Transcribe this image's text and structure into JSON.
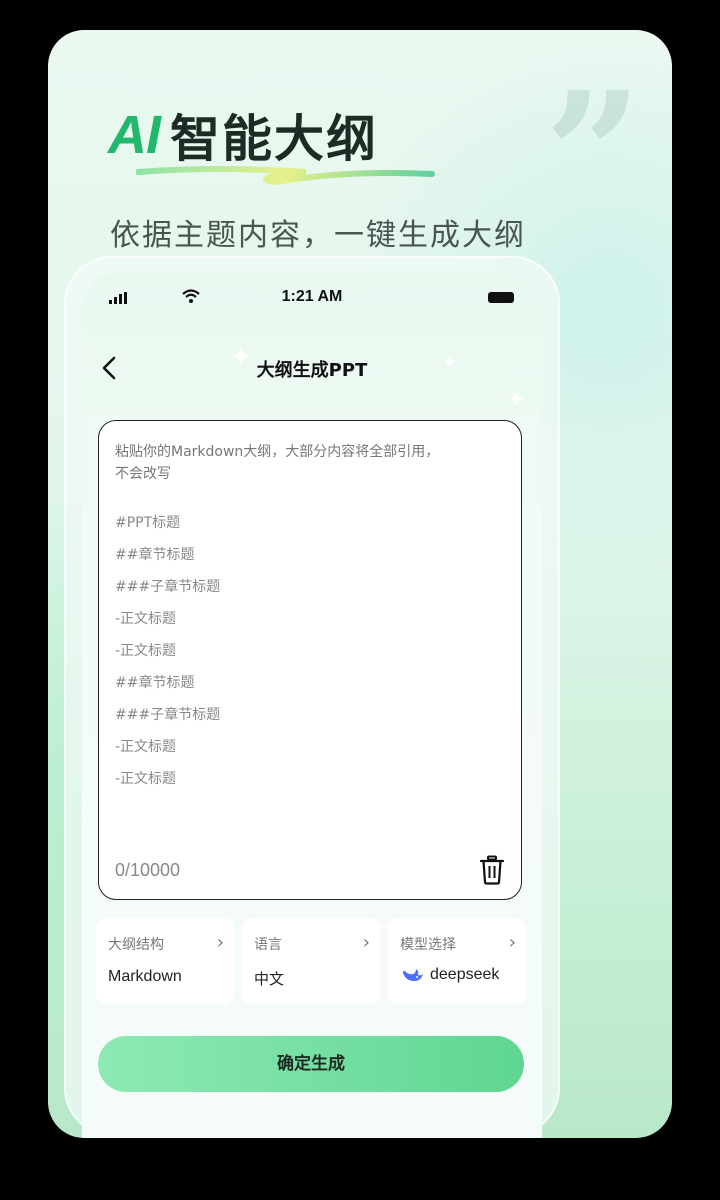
{
  "promo": {
    "headline_ai": "AI",
    "headline_cn": "智能大纲",
    "subtitle": "依据主题内容，一键生成大纲"
  },
  "status_bar": {
    "time": "1:21 AM"
  },
  "nav": {
    "title": "大纲生成PPT"
  },
  "editor": {
    "placeholder_line1": "粘贴你的Markdown大纲，大部分内容将全部引用，",
    "placeholder_line2": "不会改写",
    "outline_lines": [
      "#PPT标题",
      "##章节标题",
      "###子章节标题",
      "-正文标题",
      "-正文标题",
      "##章节标题",
      "###子章节标题",
      "-正文标题",
      "-正文标题"
    ],
    "counter": "0/10000"
  },
  "options": [
    {
      "label": "大纲结构",
      "value": "Markdown"
    },
    {
      "label": "语言",
      "value": "中文"
    },
    {
      "label": "模型选择",
      "value": "deepseek"
    }
  ],
  "confirm_label": "确定生成",
  "colors": {
    "accent_green": "#22b86c",
    "button_start": "#8ee9b4",
    "button_end": "#5fd692",
    "deepseek_blue": "#4d6bfe"
  },
  "icons": [
    "quote-mark-icon",
    "signal-icon",
    "wifi-icon",
    "battery-icon",
    "back-arrow-icon",
    "trash-icon",
    "chevron-right-icon",
    "deepseek-whale-icon"
  ]
}
